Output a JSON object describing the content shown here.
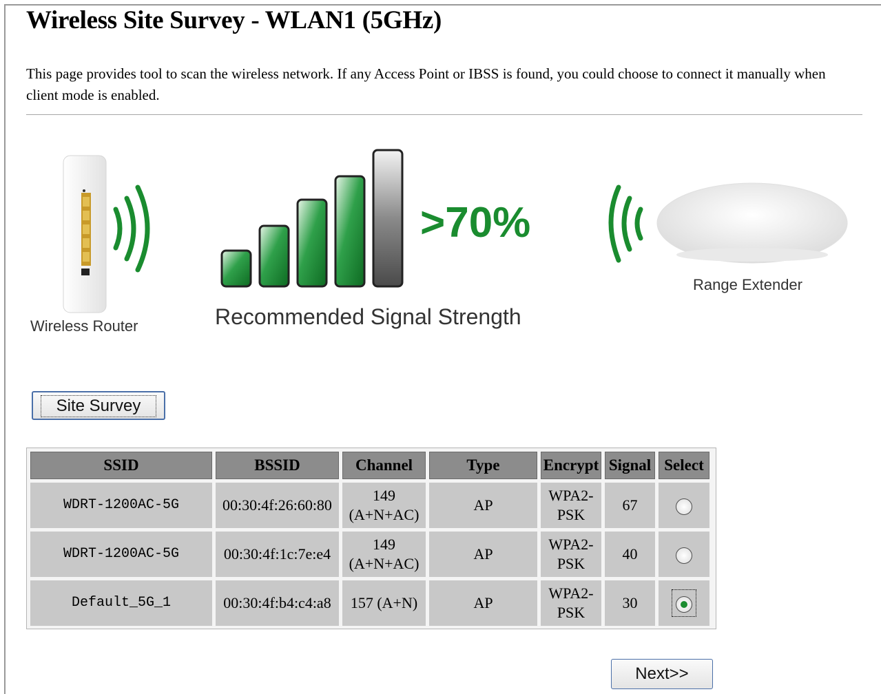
{
  "page": {
    "title": "Wireless Site Survey - WLAN1 (5GHz)",
    "description": "This page provides tool to scan the wireless network. If any Access Point or IBSS is found, you could choose to connect it manually when client mode is enabled."
  },
  "banner": {
    "router_label": "Wireless Router",
    "signal_percent": ">70%",
    "signal_caption": "Recommended Signal Strength",
    "extender_label": "Range Extender",
    "colors": {
      "signal_green": "#1a8c2f",
      "bar_gray": "#555555"
    }
  },
  "buttons": {
    "site_survey": "Site Survey",
    "next": "Next>>"
  },
  "table": {
    "headers": [
      "SSID",
      "BSSID",
      "Channel",
      "Type",
      "Encrypt",
      "Signal",
      "Select"
    ],
    "rows": [
      {
        "ssid": "WDRT-1200AC-5G",
        "bssid": "00:30:4f:26:60:80",
        "channel_line1": "149",
        "channel_line2": "(A+N+AC)",
        "type": "AP",
        "encrypt_line1": "WPA2-",
        "encrypt_line2": "PSK",
        "signal": "67",
        "selected": false
      },
      {
        "ssid": "WDRT-1200AC-5G",
        "bssid": "00:30:4f:1c:7e:e4",
        "channel_line1": "149",
        "channel_line2": "(A+N+AC)",
        "type": "AP",
        "encrypt_line1": "WPA2-",
        "encrypt_line2": "PSK",
        "signal": "40",
        "selected": false
      },
      {
        "ssid": "Default_5G_1",
        "bssid": "00:30:4f:b4:c4:a8",
        "channel_line1": "157 (A+N)",
        "channel_line2": "",
        "type": "AP",
        "encrypt_line1": "WPA2-",
        "encrypt_line2": "PSK",
        "signal": "30",
        "selected": true
      }
    ]
  }
}
